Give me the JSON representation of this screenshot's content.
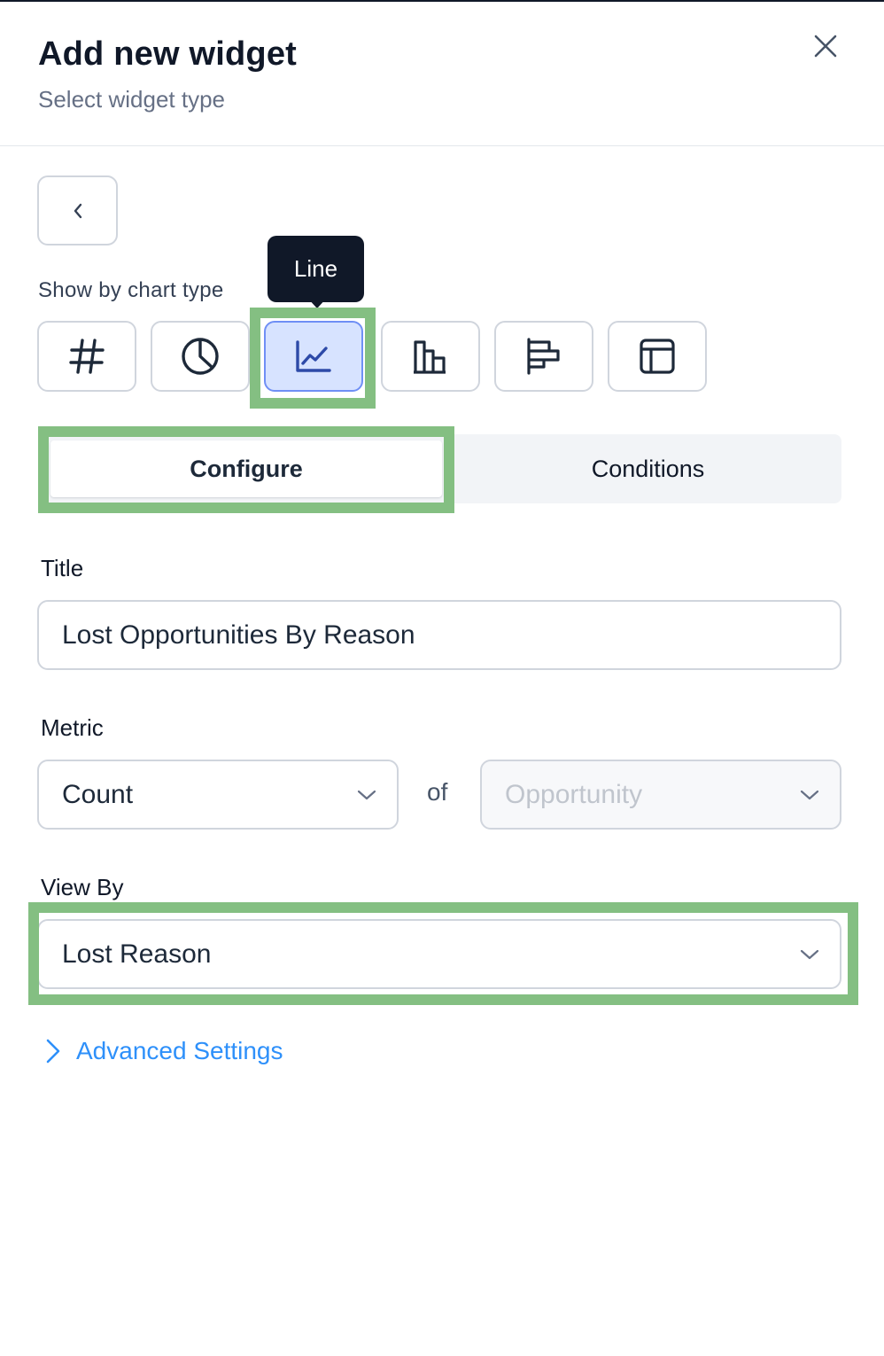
{
  "header": {
    "title": "Add new widget",
    "subtitle": "Select widget type"
  },
  "chart_types": {
    "label": "Show by chart type",
    "tooltip": "Line",
    "items": [
      {
        "icon": "hash-icon",
        "selected": false
      },
      {
        "icon": "pie-chart-icon",
        "selected": false
      },
      {
        "icon": "line-chart-icon",
        "selected": true
      },
      {
        "icon": "bar-chart-icon",
        "selected": false
      },
      {
        "icon": "horizontal-bar-chart-icon",
        "selected": false
      },
      {
        "icon": "table-icon",
        "selected": false
      }
    ]
  },
  "tabs": {
    "configure": "Configure",
    "conditions": "Conditions",
    "active": "configure"
  },
  "form": {
    "title_label": "Title",
    "title_value": "Lost Opportunities By Reason",
    "metric_label": "Metric",
    "metric_value": "Count",
    "of_text": "of",
    "object_placeholder": "Opportunity",
    "view_by_label": "View By",
    "view_by_value": "Lost Reason"
  },
  "advanced": {
    "label": "Advanced Settings"
  },
  "colors": {
    "highlight": "#84bf82",
    "selected_bg": "#d7e3ff",
    "link": "#2e90fa",
    "tooltip_bg": "#101828"
  }
}
